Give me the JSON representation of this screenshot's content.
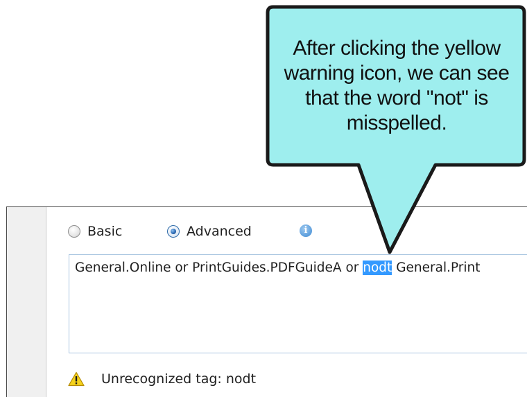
{
  "callout": {
    "text": "After clicking the yellow warning icon, we can see that the word \"not\" is misspelled.",
    "fill_color": "#9eeeee",
    "border_color": "#1a1a1a"
  },
  "mode": {
    "basic_label": "Basic",
    "advanced_label": "Advanced",
    "selected": "Advanced",
    "info_icon": "info-icon"
  },
  "expression": {
    "before": "General.Online or PrintGuides.PDFGuideA or ",
    "selected_word": "nodt",
    "after": " General.Print",
    "selection_color": "#3399ff"
  },
  "warning": {
    "icon": "warning-icon",
    "message": "Unrecognized tag: nodt"
  }
}
